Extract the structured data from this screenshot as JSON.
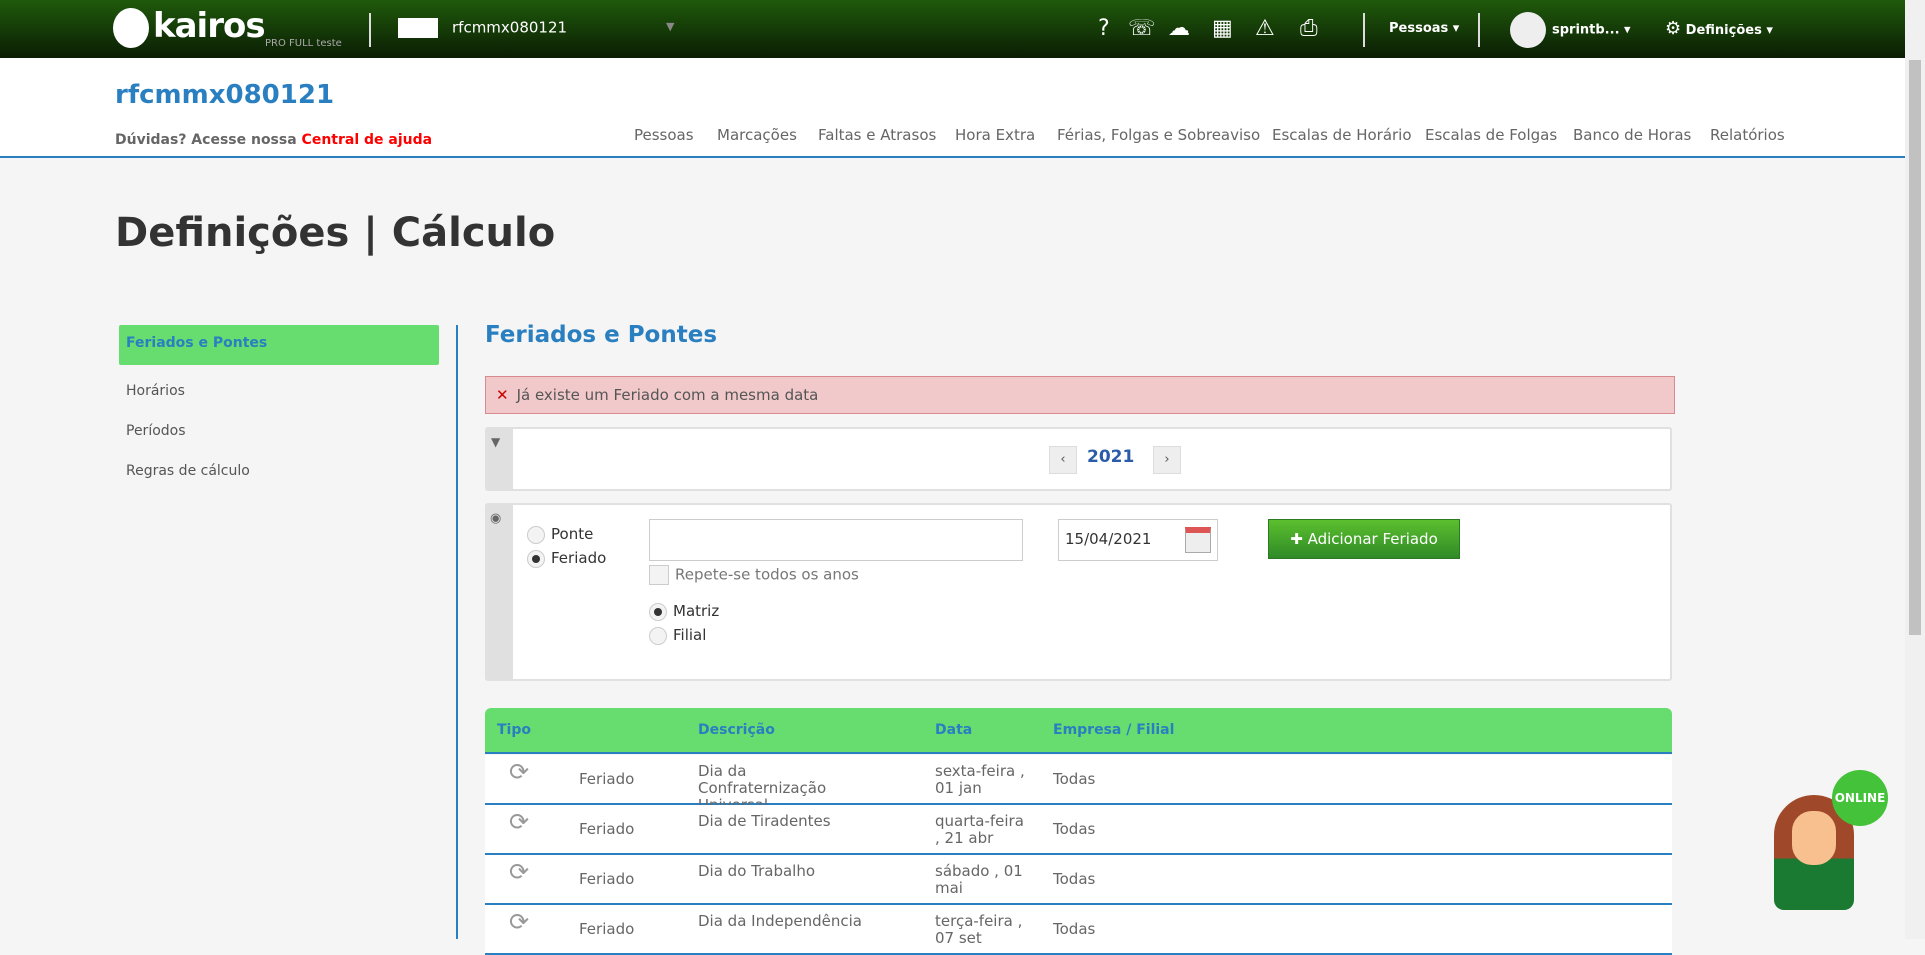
{
  "topbar": {
    "logo": "kairos",
    "edition": "PRO FULL teste",
    "company": "rfcmmx080121",
    "pessoas": "Pessoas",
    "user": "sprintb...",
    "definicoes": "Definições"
  },
  "header": {
    "company_title": "rfcmmx080121",
    "help_prefix": "Dúvidas? Acesse nossa",
    "help_link": "Central de ajuda",
    "nav": [
      "Pessoas",
      "Marcações",
      "Faltas e Atrasos",
      "Hora Extra",
      "Férias, Folgas e Sobreaviso",
      "Escalas de Horário",
      "Escalas de Folgas",
      "Banco de Horas",
      "Relatórios"
    ]
  },
  "page_title": "Definições | Cálculo",
  "sidebar": [
    "Feriados e Pontes",
    "Horários",
    "Períodos",
    "Regras de cálculo"
  ],
  "section_title": "Feriados e Pontes",
  "error": "Já existe um Feriado com a mesma data",
  "year": "2021",
  "form": {
    "ponte": "Ponte",
    "feriado": "Feriado",
    "description": "",
    "date": "15/04/2021",
    "repeat": "Repete-se todos os anos",
    "matriz": "Matriz",
    "filial": "Filial",
    "add": "Adicionar Feriado"
  },
  "table": {
    "headers": [
      "Tipo",
      "Descrição",
      "Data",
      "Empresa / Filial"
    ],
    "rows": [
      {
        "tipo": "Feriado",
        "desc": "Dia da Confraternização Universal",
        "data": "sexta-feira , 01 jan",
        "empresa": "Todas"
      },
      {
        "tipo": "Feriado",
        "desc": "Dia de Tiradentes",
        "data": "quarta-feira , 21 abr",
        "empresa": "Todas"
      },
      {
        "tipo": "Feriado",
        "desc": "Dia do Trabalho",
        "data": "sábado , 01 mai",
        "empresa": "Todas"
      },
      {
        "tipo": "Feriado",
        "desc": "Dia da Independência",
        "data": "terça-feira , 07 set",
        "empresa": "Todas"
      }
    ]
  },
  "chat": {
    "badge": "ONLINE"
  }
}
